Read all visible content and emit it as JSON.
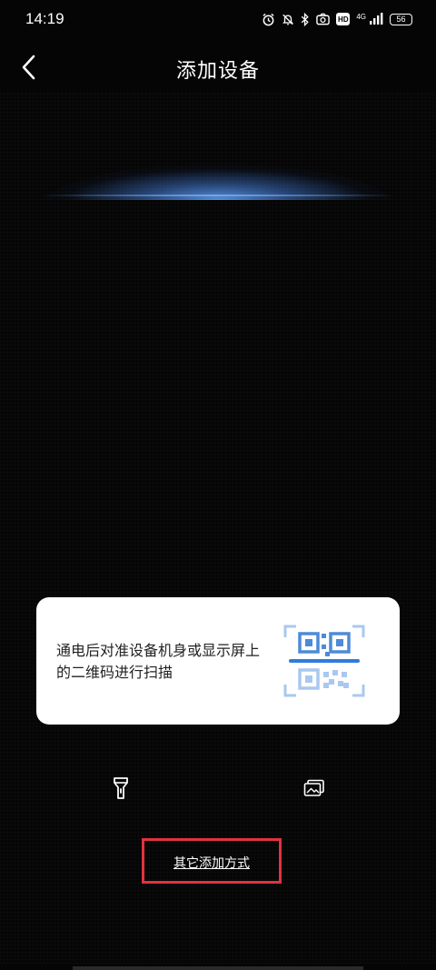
{
  "status_bar": {
    "time": "14:19",
    "network": "4G",
    "hd": "HD",
    "battery": "56"
  },
  "header": {
    "title": "添加设备"
  },
  "hint_card": {
    "text": "通电后对准设备机身或显示屏上的二维码进行扫描"
  },
  "actions": {
    "other_methods_label": "其它添加方式"
  },
  "colors": {
    "background": "#050505",
    "card": "#ffffff",
    "accent_blue": "#5a96e6",
    "highlight_red": "#e0333f"
  },
  "icons": {
    "back": "chevron-left-icon",
    "flashlight": "flashlight-icon",
    "gallery": "gallery-icon",
    "qr": "qr-code-icon"
  }
}
